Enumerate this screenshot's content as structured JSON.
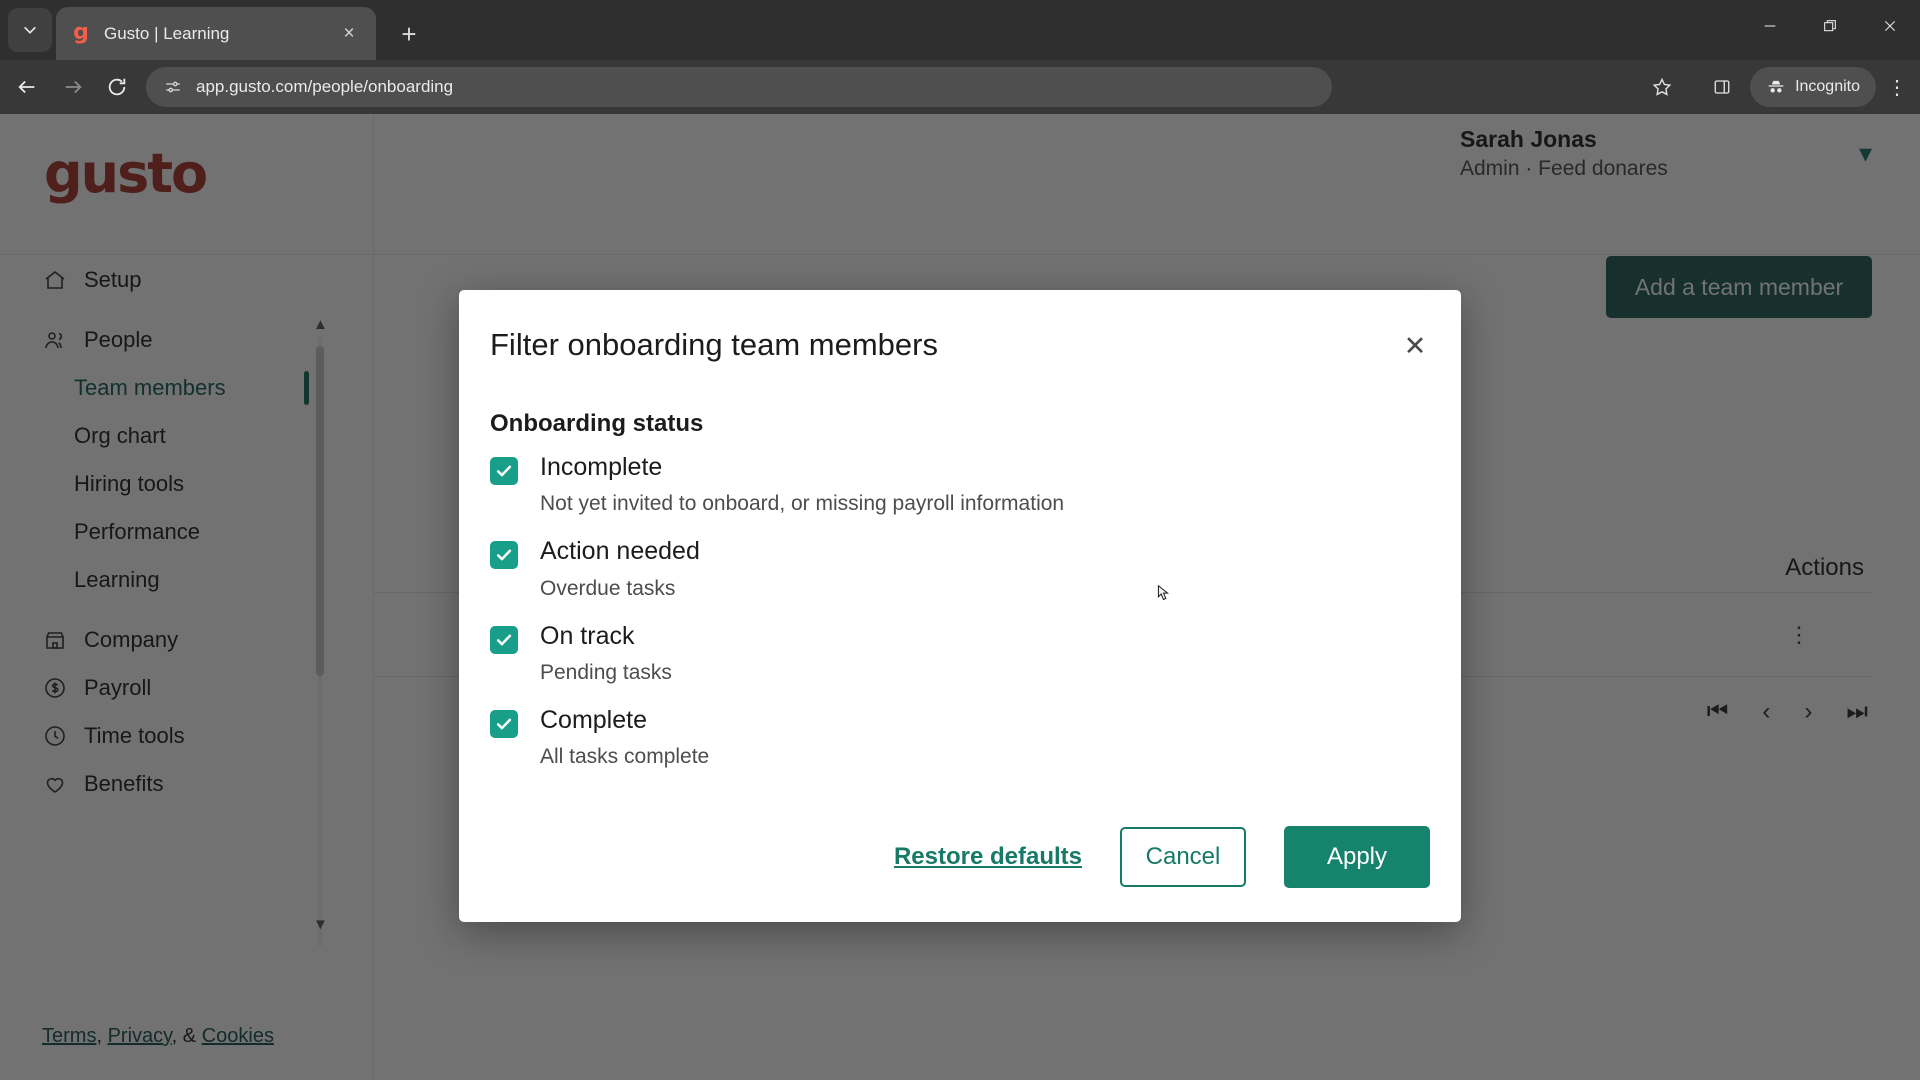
{
  "browser": {
    "tab": {
      "title": "Gusto | Learning",
      "favicon_letter": "g",
      "close_label": "×"
    },
    "new_tab_label": "+",
    "url": "app.gusto.com/people/onboarding",
    "profile_label": "Incognito",
    "window": {
      "minimize": "minimize-icon",
      "maximize": "restore-icon",
      "close": "close-icon"
    }
  },
  "page": {
    "brand": "gusto",
    "user": {
      "name": "Sarah Jonas",
      "role": "Admin · Feed donares"
    },
    "add_button": "Add a team member",
    "actions_column": "Actions",
    "sidebar": {
      "items": [
        {
          "label": "Setup",
          "icon": "home-icon",
          "type": "top"
        },
        {
          "label": "People",
          "icon": "people-icon",
          "type": "top"
        },
        {
          "label": "Team members",
          "type": "sub",
          "active": true
        },
        {
          "label": "Org chart",
          "type": "sub",
          "active": false
        },
        {
          "label": "Hiring tools",
          "type": "sub",
          "active": false
        },
        {
          "label": "Performance",
          "type": "sub",
          "active": false
        },
        {
          "label": "Learning",
          "type": "sub",
          "active": false
        },
        {
          "label": "Company",
          "icon": "building-icon",
          "type": "top"
        },
        {
          "label": "Payroll",
          "icon": "dollar-circle-icon",
          "type": "top"
        },
        {
          "label": "Time tools",
          "icon": "clock-icon",
          "type": "top"
        },
        {
          "label": "Benefits",
          "icon": "heart-icon",
          "type": "top"
        }
      ],
      "legal": {
        "terms": "Terms",
        "privacy": "Privacy",
        "cookies": "Cookies",
        "sep1": ", ",
        "sep2": ", & "
      }
    },
    "pagination": [
      "⏮",
      "‹",
      "›",
      "⏭"
    ]
  },
  "modal": {
    "title": "Filter onboarding team members",
    "close_label": "✕",
    "group_label": "Onboarding status",
    "options": [
      {
        "label": "Incomplete",
        "desc": "Not yet invited to onboard, or missing payroll information",
        "checked": true
      },
      {
        "label": "Action needed",
        "desc": "Overdue tasks",
        "checked": true
      },
      {
        "label": "On track",
        "desc": "Pending tasks",
        "checked": true
      },
      {
        "label": "Complete",
        "desc": "All tasks complete",
        "checked": true
      }
    ],
    "restore_label": "Restore defaults",
    "cancel_label": "Cancel",
    "apply_label": "Apply"
  },
  "colors": {
    "brand_red": "#a93226",
    "teal": "#16846d",
    "checkbox_teal": "#199e89",
    "dark_teal_button": "#1d5a53",
    "link_teal": "#177a66"
  }
}
